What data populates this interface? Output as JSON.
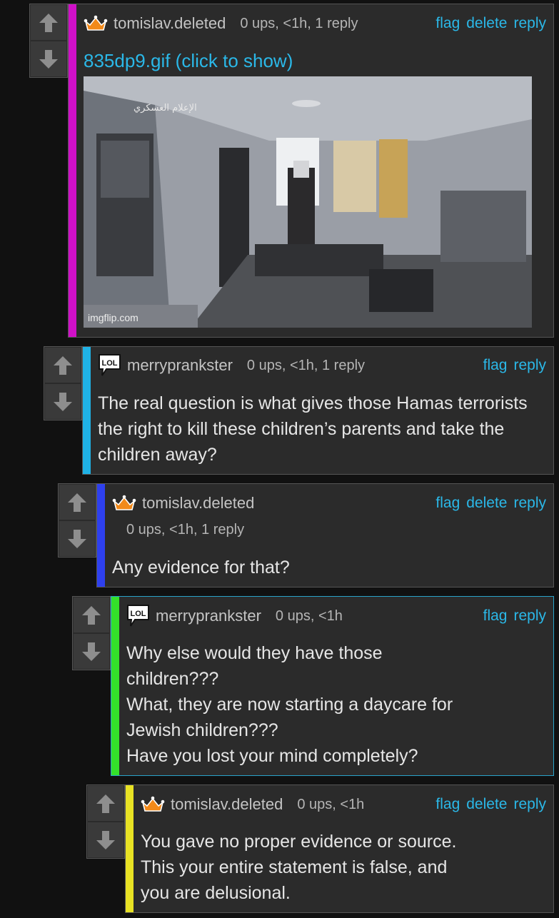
{
  "colors": {
    "link": "#2bb8e8",
    "bar_1": "#d010c8",
    "bar_2": "#1fb2e6",
    "bar_3": "#2e40ee",
    "bar_4": "#34e02a",
    "bar_5": "#e8e224",
    "crown": "#f28a1a"
  },
  "icons": {
    "upvote": "arrow-up-icon",
    "downvote": "arrow-down-icon",
    "tomislav_badge": "crown-icon",
    "merry_badge": "lol-speech-bubble-icon"
  },
  "comments": [
    {
      "user": "tomislav.deleted",
      "meta": "0 ups, <1h, 1 reply",
      "actions": [
        "flag",
        "delete",
        "reply"
      ],
      "gif_link": "835dp9.gif (click to show)",
      "gif_watermark": "imgflip.com"
    },
    {
      "user": "merryprankster",
      "meta": "0 ups, <1h, 1 reply",
      "actions": [
        "flag",
        "reply"
      ],
      "text": "The real question is what gives those Hamas terrorists the right to kill these children’s parents and take the children away?"
    },
    {
      "user": "tomislav.deleted",
      "meta": "0 ups, <1h, 1 reply",
      "actions": [
        "flag",
        "delete",
        "reply"
      ],
      "text": "Any evidence for that?"
    },
    {
      "user": "merryprankster",
      "meta": "0 ups, <1h",
      "actions": [
        "flag",
        "reply"
      ],
      "text_lines": [
        "Why else would they have those",
        "children???",
        "What, they are now starting a daycare for",
        "Jewish children???",
        "Have you lost your mind completely?"
      ]
    },
    {
      "user": "tomislav.deleted",
      "meta": "0 ups, <1h",
      "actions": [
        "flag",
        "delete",
        "reply"
      ],
      "text_lines": [
        "You gave no proper evidence or source.",
        "This your entire statement is false, and",
        "you are delusional."
      ]
    }
  ]
}
